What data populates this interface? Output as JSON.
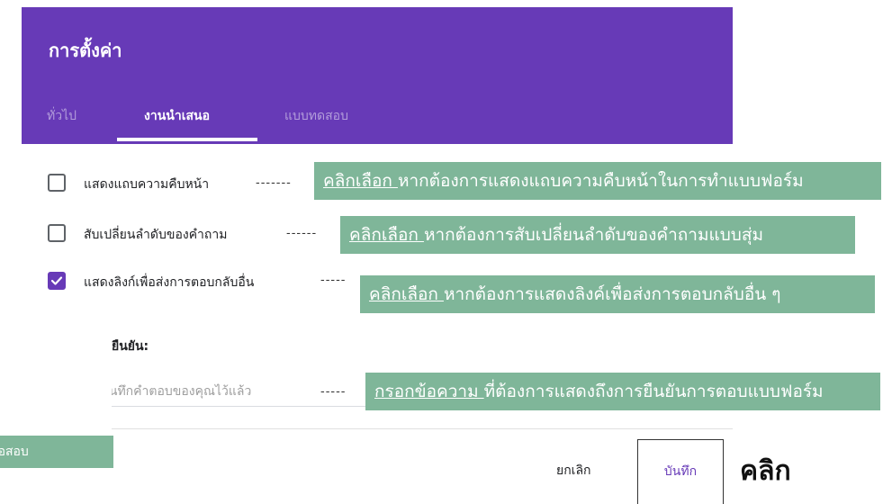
{
  "header": {
    "title": "การตั้งค่า",
    "tabs": [
      {
        "label": "ทั่วไป",
        "active": false
      },
      {
        "label": "งานนำเสนอ",
        "active": true
      },
      {
        "label": "แบบทดสอบ",
        "active": false
      }
    ],
    "color": "#673ab7"
  },
  "options": [
    {
      "label": "แสดงแถบความคืบหน้า",
      "checked": false,
      "dashes": "-------",
      "callout_link": "คลิกเลือก ",
      "callout_text": "หากต้องการแสดงแถบความคืบหน้าในการทำแบบฟอร์ม"
    },
    {
      "label": "สับเปลี่ยนลำดับของคำถาม",
      "checked": false,
      "dashes": "------",
      "callout_link": "คลิกเลือก ",
      "callout_text": "หากต้องการสับเปลี่ยนลำดับของคำถามแบบสุ่ม"
    },
    {
      "label": "แสดงลิงก์เพื่อส่งการตอบกลับอื่น",
      "checked": true,
      "dashes": "-----",
      "callout_link": "คลิกเลือก ",
      "callout_text": "หากต้องการแสดงลิงค์เพื่อส่งการตอบกลับอื่น ๆ"
    }
  ],
  "confirmation": {
    "label": "ยืนยัน:",
    "value": "บันทึกคำตอบของคุณไว้แล้ว",
    "dashes": "-----",
    "callout_link": "กรอกข้อความ ",
    "callout_text": "ที่ต้องการแสดงถึงการยืนยันการตอบแบบฟอร์ม"
  },
  "side_tag": "ข้อสอบ",
  "footer": {
    "cancel_label": "ยกเลิก",
    "save_label": "บันทึก",
    "click_label": "คลิก"
  },
  "callout_color": "#7fb699"
}
